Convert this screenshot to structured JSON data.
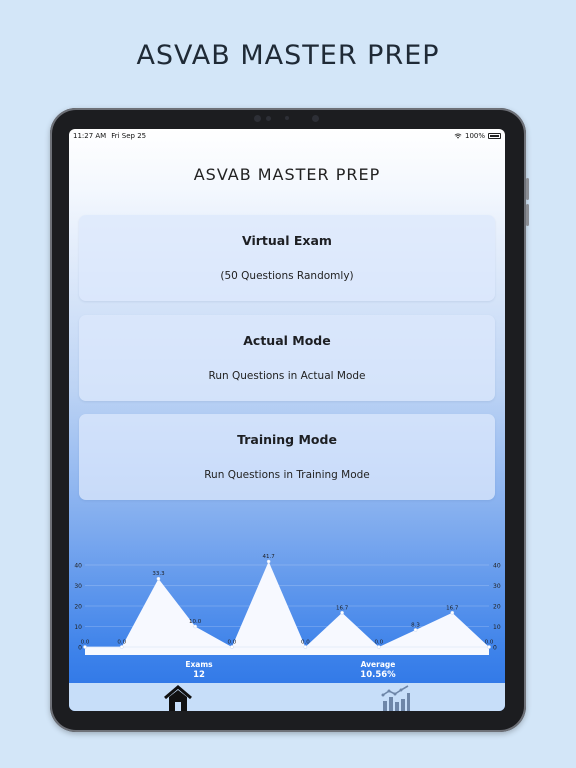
{
  "promo": {
    "title": "ASVAB MASTER PREP"
  },
  "status_bar": {
    "time": "11:27 AM",
    "date": "Fri Sep 25",
    "battery": "100%"
  },
  "app": {
    "title": "ASVAB MASTER PREP"
  },
  "cards": [
    {
      "title": "Virtual Exam",
      "subtitle": "(50 Questions Randomly)"
    },
    {
      "title": "Actual Mode",
      "subtitle": "Run Questions in Actual Mode"
    },
    {
      "title": "Training Mode",
      "subtitle": "Run Questions in Training Mode"
    }
  ],
  "stats": {
    "exams_label": "Exams",
    "exams_value": "12",
    "average_label": "Average",
    "average_value": "10.56%"
  },
  "tabs": [
    {
      "name": "home",
      "icon": "home-icon"
    },
    {
      "name": "stats",
      "icon": "bar-chart-icon"
    }
  ],
  "colors": {
    "accent": "#2a73e6",
    "tab_bar": "#c7def9",
    "card": "#dce8fc"
  },
  "chart_data": {
    "type": "area",
    "x": [
      1,
      2,
      3,
      4,
      5,
      6,
      7,
      8,
      9,
      10,
      11,
      12
    ],
    "values": [
      0.0,
      0.0,
      33.3,
      10.0,
      0.0,
      41.7,
      0.0,
      16.7,
      0.0,
      8.3,
      16.7,
      0.0
    ],
    "value_labels": [
      "0.0",
      "0.0",
      "33.3",
      "10.0",
      "0.0",
      "41.7",
      "0.0",
      "16.7",
      "0.0",
      "8.3",
      "16.7",
      "0.0"
    ],
    "ylim": [
      0,
      40
    ],
    "yticks": [
      "0",
      "10",
      "20",
      "30",
      "40"
    ],
    "grid": true
  }
}
